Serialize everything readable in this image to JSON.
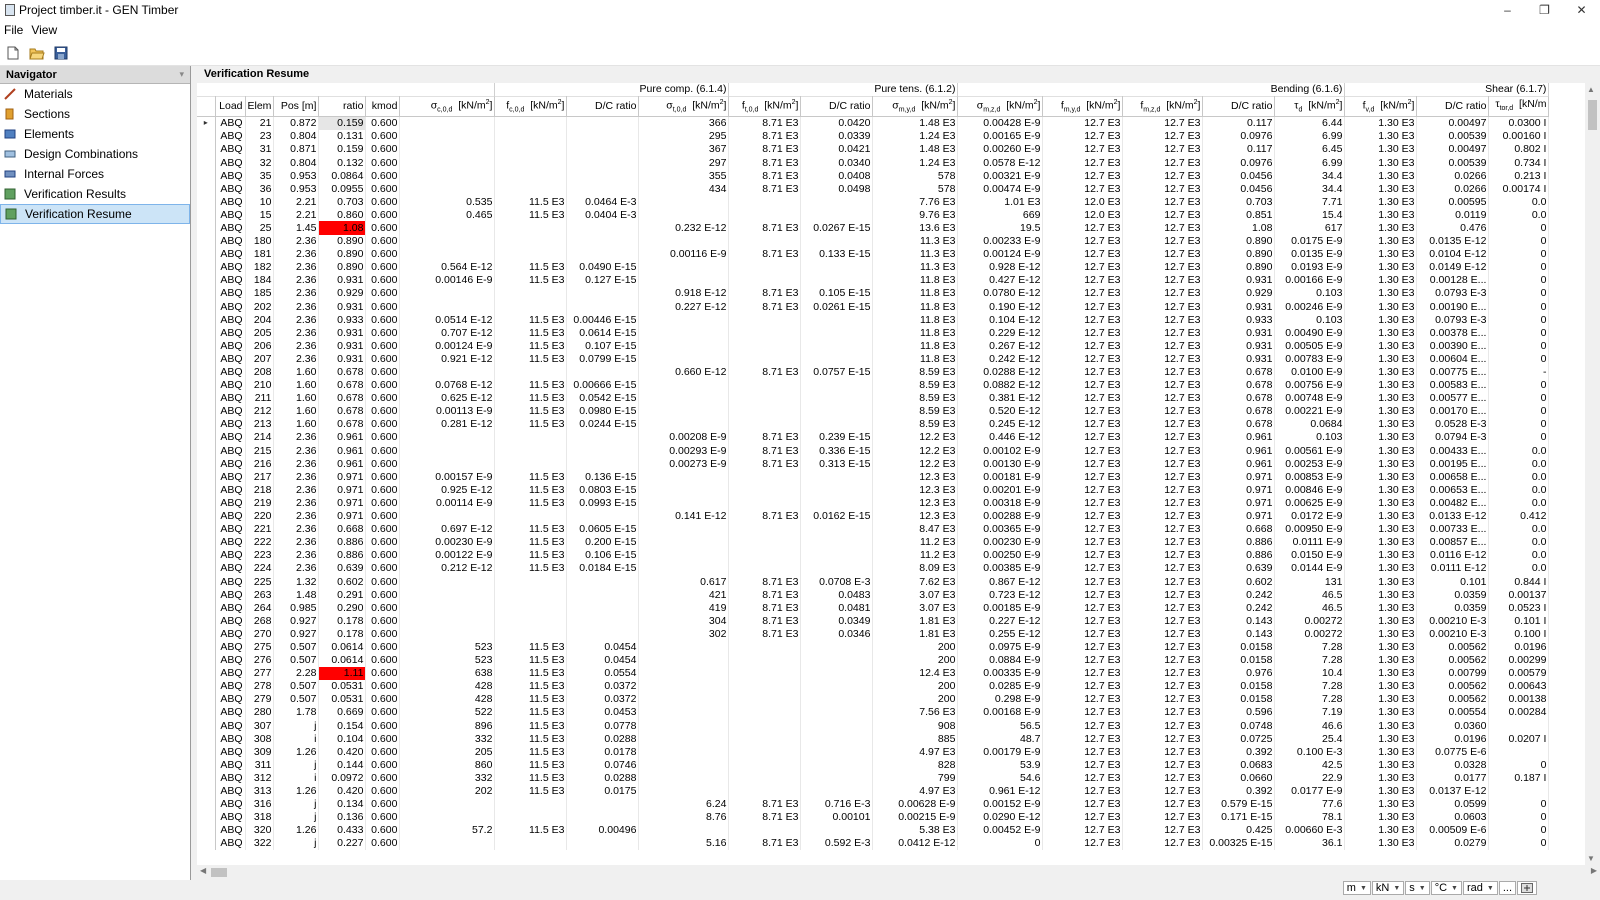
{
  "window": {
    "title": "Project timber.it - GEN Timber",
    "minimize": "–",
    "maximize": "❐",
    "close": "✕"
  },
  "menu": [
    "File",
    "View"
  ],
  "toolbar": [
    "new-file-icon",
    "open-folder-icon",
    "save-icon"
  ],
  "navigator": {
    "title": "Navigator",
    "items": [
      {
        "label": "Materials",
        "icon": "materials-icon"
      },
      {
        "label": "Sections",
        "icon": "sections-icon"
      },
      {
        "label": "Elements",
        "icon": "elements-icon"
      },
      {
        "label": "Design Combinations",
        "icon": "design-combinations-icon"
      },
      {
        "label": "Internal Forces",
        "icon": "internal-forces-icon"
      },
      {
        "label": "Verification Results",
        "icon": "verification-results-icon"
      },
      {
        "label": "Verification Resume",
        "icon": "verification-resume-icon",
        "selected": true
      }
    ]
  },
  "panel_title": "Verification Resume",
  "colors": {
    "highlight_red": "#ff0000",
    "selection_bg": "#cce4f7"
  },
  "column_groups": [
    {
      "label": "",
      "span": 7
    },
    {
      "label": "Pure comp. (6.1.4)",
      "span": 3
    },
    {
      "label": "Pure tens. (6.1.2)",
      "span": 3
    },
    {
      "label": "Bending (6.1.6)",
      "span": 5
    },
    {
      "label": "Shear (6.1.7)",
      "span": 3
    }
  ],
  "columns": [
    "",
    "Load",
    "Elem",
    "Pos [m]",
    "ratio",
    "kmod",
    "σc,0,d  [kN/m2]",
    "fc,0,d  [kN/m2]",
    "D/C ratio",
    "σt,0,d  [kN/m2]",
    "ft,0,d  [kN/m2]",
    "D/C ratio",
    "σm,y,d  [kN/m2]",
    "σm,z,d  [kN/m2]",
    "fm,y,d  [kN/m2]",
    "fm,z,d  [kN/m2]",
    "D/C ratio",
    "τd  [kN/m2]",
    "fv,d  [kN/m2]",
    "D/C ratio",
    "τtor,d  [kN/m"
  ],
  "rows": [
    [
      "ABQ",
      "21",
      "0.872",
      "0.159",
      "0.600",
      "",
      "",
      "",
      "366",
      "8.71 E3",
      "0.0420",
      "1.48 E3",
      "0.00428 E-9",
      "12.7 E3",
      "12.7 E3",
      "0.117",
      "6.44",
      "1.30 E3",
      "0.00497",
      "0.0300 I"
    ],
    [
      "ABQ",
      "23",
      "0.804",
      "0.131",
      "0.600",
      "",
      "",
      "",
      "295",
      "8.71 E3",
      "0.0339",
      "1.24 E3",
      "0.00165 E-9",
      "12.7 E3",
      "12.7 E3",
      "0.0976",
      "6.99",
      "1.30 E3",
      "0.00539",
      "0.00160 I"
    ],
    [
      "ABQ",
      "31",
      "0.871",
      "0.159",
      "0.600",
      "",
      "",
      "",
      "367",
      "8.71 E3",
      "0.0421",
      "1.48 E3",
      "0.00260 E-9",
      "12.7 E3",
      "12.7 E3",
      "0.117",
      "6.45",
      "1.30 E3",
      "0.00497",
      "0.802 I"
    ],
    [
      "ABQ",
      "32",
      "0.804",
      "0.132",
      "0.600",
      "",
      "",
      "",
      "297",
      "8.71 E3",
      "0.0340",
      "1.24 E3",
      "0.0578 E-12",
      "12.7 E3",
      "12.7 E3",
      "0.0976",
      "6.99",
      "1.30 E3",
      "0.00539",
      "0.734 I"
    ],
    [
      "ABQ",
      "35",
      "0.953",
      "0.0864",
      "0.600",
      "",
      "",
      "",
      "355",
      "8.71 E3",
      "0.0408",
      "578",
      "0.00321 E-9",
      "12.7 E3",
      "12.7 E3",
      "0.0456",
      "34.4",
      "1.30 E3",
      "0.0266",
      "0.213 I"
    ],
    [
      "ABQ",
      "36",
      "0.953",
      "0.0955",
      "0.600",
      "",
      "",
      "",
      "434",
      "8.71 E3",
      "0.0498",
      "578",
      "0.00474 E-9",
      "12.7 E3",
      "12.7 E3",
      "0.0456",
      "34.4",
      "1.30 E3",
      "0.0266",
      "0.00174 I"
    ],
    [
      "ABQ",
      "10",
      "2.21",
      "0.703",
      "0.600",
      "0.535",
      "11.5 E3",
      "0.0464 E-3",
      "",
      "",
      "",
      "7.76 E3",
      "1.01 E3",
      "12.0 E3",
      "12.7 E3",
      "0.703",
      "7.71",
      "1.30 E3",
      "0.00595",
      "0.0"
    ],
    [
      "ABQ",
      "15",
      "2.21",
      "0.860",
      "0.600",
      "0.465",
      "11.5 E3",
      "0.0404 E-3",
      "",
      "",
      "",
      "9.76 E3",
      "669",
      "12.0 E3",
      "12.7 E3",
      "0.851",
      "15.4",
      "1.30 E3",
      "0.0119",
      "0.0"
    ],
    [
      "ABQ",
      "25",
      "1.45",
      "1.08",
      "0.600",
      "",
      "",
      "",
      "0.232 E-12",
      "8.71 E3",
      "0.0267 E-15",
      "13.6 E3",
      "19.5",
      "12.7 E3",
      "12.7 E3",
      "1.08",
      "617",
      "1.30 E3",
      "0.476",
      "0"
    ],
    [
      "ABQ",
      "180",
      "2.36",
      "0.890",
      "0.600",
      "",
      "",
      "",
      "",
      "",
      "",
      "11.3 E3",
      "0.00233 E-9",
      "12.7 E3",
      "12.7 E3",
      "0.890",
      "0.0175 E-9",
      "1.30 E3",
      "0.0135 E-12",
      "0"
    ],
    [
      "ABQ",
      "181",
      "2.36",
      "0.890",
      "0.600",
      "",
      "",
      "",
      "0.00116 E-9",
      "8.71 E3",
      "0.133 E-15",
      "11.3 E3",
      "0.00124 E-9",
      "12.7 E3",
      "12.7 E3",
      "0.890",
      "0.0135 E-9",
      "1.30 E3",
      "0.0104 E-12",
      "0"
    ],
    [
      "ABQ",
      "182",
      "2.36",
      "0.890",
      "0.600",
      "0.564 E-12",
      "11.5 E3",
      "0.0490 E-15",
      "",
      "",
      "",
      "11.3 E3",
      "0.928 E-12",
      "12.7 E3",
      "12.7 E3",
      "0.890",
      "0.0193 E-9",
      "1.30 E3",
      "0.0149 E-12",
      "0"
    ],
    [
      "ABQ",
      "184",
      "2.36",
      "0.931",
      "0.600",
      "0.00146 E-9",
      "11.5 E3",
      "0.127 E-15",
      "",
      "",
      "",
      "11.8 E3",
      "0.427 E-12",
      "12.7 E3",
      "12.7 E3",
      "0.931",
      "0.00166 E-9",
      "1.30 E3",
      "0.00128 E...",
      "0"
    ],
    [
      "ABQ",
      "185",
      "2.36",
      "0.929",
      "0.600",
      "",
      "",
      "",
      "0.918 E-12",
      "8.71 E3",
      "0.105 E-15",
      "11.8 E3",
      "0.0780 E-12",
      "12.7 E3",
      "12.7 E3",
      "0.929",
      "0.103",
      "1.30 E3",
      "0.0793 E-3",
      "0"
    ],
    [
      "ABQ",
      "202",
      "2.36",
      "0.931",
      "0.600",
      "",
      "",
      "",
      "0.227 E-12",
      "8.71 E3",
      "0.0261 E-15",
      "11.8 E3",
      "0.190 E-12",
      "12.7 E3",
      "12.7 E3",
      "0.931",
      "0.00246 E-9",
      "1.30 E3",
      "0.00190 E...",
      "0"
    ],
    [
      "ABQ",
      "204",
      "2.36",
      "0.933",
      "0.600",
      "0.0514 E-12",
      "11.5 E3",
      "0.00446 E-15",
      "",
      "",
      "",
      "11.8 E3",
      "0.104 E-12",
      "12.7 E3",
      "12.7 E3",
      "0.933",
      "0.103",
      "1.30 E3",
      "0.0793 E-3",
      "0"
    ],
    [
      "ABQ",
      "205",
      "2.36",
      "0.931",
      "0.600",
      "0.707 E-12",
      "11.5 E3",
      "0.0614 E-15",
      "",
      "",
      "",
      "11.8 E3",
      "0.229 E-12",
      "12.7 E3",
      "12.7 E3",
      "0.931",
      "0.00490 E-9",
      "1.30 E3",
      "0.00378 E...",
      "0"
    ],
    [
      "ABQ",
      "206",
      "2.36",
      "0.931",
      "0.600",
      "0.00124 E-9",
      "11.5 E3",
      "0.107 E-15",
      "",
      "",
      "",
      "11.8 E3",
      "0.267 E-12",
      "12.7 E3",
      "12.7 E3",
      "0.931",
      "0.00505 E-9",
      "1.30 E3",
      "0.00390 E...",
      "0"
    ],
    [
      "ABQ",
      "207",
      "2.36",
      "0.931",
      "0.600",
      "0.921 E-12",
      "11.5 E3",
      "0.0799 E-15",
      "",
      "",
      "",
      "11.8 E3",
      "0.242 E-12",
      "12.7 E3",
      "12.7 E3",
      "0.931",
      "0.00783 E-9",
      "1.30 E3",
      "0.00604 E...",
      "0"
    ],
    [
      "ABQ",
      "208",
      "1.60",
      "0.678",
      "0.600",
      "",
      "",
      "",
      "0.660 E-12",
      "8.71 E3",
      "0.0757 E-15",
      "8.59 E3",
      "0.0288 E-12",
      "12.7 E3",
      "12.7 E3",
      "0.678",
      "0.0100 E-9",
      "1.30 E3",
      "0.00775 E...",
      "-"
    ],
    [
      "ABQ",
      "210",
      "1.60",
      "0.678",
      "0.600",
      "0.0768 E-12",
      "11.5 E3",
      "0.00666 E-15",
      "",
      "",
      "",
      "8.59 E3",
      "0.0882 E-12",
      "12.7 E3",
      "12.7 E3",
      "0.678",
      "0.00756 E-9",
      "1.30 E3",
      "0.00583 E...",
      "0"
    ],
    [
      "ABQ",
      "211",
      "1.60",
      "0.678",
      "0.600",
      "0.625 E-12",
      "11.5 E3",
      "0.0542 E-15",
      "",
      "",
      "",
      "8.59 E3",
      "0.381 E-12",
      "12.7 E3",
      "12.7 E3",
      "0.678",
      "0.00748 E-9",
      "1.30 E3",
      "0.00577 E...",
      "0"
    ],
    [
      "ABQ",
      "212",
      "1.60",
      "0.678",
      "0.600",
      "0.00113 E-9",
      "11.5 E3",
      "0.0980 E-15",
      "",
      "",
      "",
      "8.59 E3",
      "0.520 E-12",
      "12.7 E3",
      "12.7 E3",
      "0.678",
      "0.00221 E-9",
      "1.30 E3",
      "0.00170 E...",
      "0"
    ],
    [
      "ABQ",
      "213",
      "1.60",
      "0.678",
      "0.600",
      "0.281 E-12",
      "11.5 E3",
      "0.0244 E-15",
      "",
      "",
      "",
      "8.59 E3",
      "0.245 E-12",
      "12.7 E3",
      "12.7 E3",
      "0.678",
      "0.0684",
      "1.30 E3",
      "0.0528 E-3",
      "0"
    ],
    [
      "ABQ",
      "214",
      "2.36",
      "0.961",
      "0.600",
      "",
      "",
      "",
      "0.00208 E-9",
      "8.71 E3",
      "0.239 E-15",
      "12.2 E3",
      "0.446 E-12",
      "12.7 E3",
      "12.7 E3",
      "0.961",
      "0.103",
      "1.30 E3",
      "0.0794 E-3",
      "0"
    ],
    [
      "ABQ",
      "215",
      "2.36",
      "0.961",
      "0.600",
      "",
      "",
      "",
      "0.00293 E-9",
      "8.71 E3",
      "0.336 E-15",
      "12.2 E3",
      "0.00102 E-9",
      "12.7 E3",
      "12.7 E3",
      "0.961",
      "0.00561 E-9",
      "1.30 E3",
      "0.00433 E...",
      "0.0"
    ],
    [
      "ABQ",
      "216",
      "2.36",
      "0.961",
      "0.600",
      "",
      "",
      "",
      "0.00273 E-9",
      "8.71 E3",
      "0.313 E-15",
      "12.2 E3",
      "0.00130 E-9",
      "12.7 E3",
      "12.7 E3",
      "0.961",
      "0.00253 E-9",
      "1.30 E3",
      "0.00195 E...",
      "0.0"
    ],
    [
      "ABQ",
      "217",
      "2.36",
      "0.971",
      "0.600",
      "0.00157 E-9",
      "11.5 E3",
      "0.136 E-15",
      "",
      "",
      "",
      "12.3 E3",
      "0.00181 E-9",
      "12.7 E3",
      "12.7 E3",
      "0.971",
      "0.00853 E-9",
      "1.30 E3",
      "0.00658 E...",
      "0.0"
    ],
    [
      "ABQ",
      "218",
      "2.36",
      "0.971",
      "0.600",
      "0.925 E-12",
      "11.5 E3",
      "0.0803 E-15",
      "",
      "",
      "",
      "12.3 E3",
      "0.00201 E-9",
      "12.7 E3",
      "12.7 E3",
      "0.971",
      "0.00846 E-9",
      "1.30 E3",
      "0.00653 E...",
      "0.0"
    ],
    [
      "ABQ",
      "219",
      "2.36",
      "0.971",
      "0.600",
      "0.00114 E-9",
      "11.5 E3",
      "0.0993 E-15",
      "",
      "",
      "",
      "12.3 E3",
      "0.00318 E-9",
      "12.7 E3",
      "12.7 E3",
      "0.971",
      "0.00625 E-9",
      "1.30 E3",
      "0.00482 E...",
      "0.0"
    ],
    [
      "ABQ",
      "220",
      "2.36",
      "0.971",
      "0.600",
      "",
      "",
      "",
      "0.141 E-12",
      "8.71 E3",
      "0.0162 E-15",
      "12.3 E3",
      "0.00288 E-9",
      "12.7 E3",
      "12.7 E3",
      "0.971",
      "0.0172 E-9",
      "1.30 E3",
      "0.0133 E-12",
      "0.412"
    ],
    [
      "ABQ",
      "221",
      "2.36",
      "0.668",
      "0.600",
      "0.697 E-12",
      "11.5 E3",
      "0.0605 E-15",
      "",
      "",
      "",
      "8.47 E3",
      "0.00365 E-9",
      "12.7 E3",
      "12.7 E3",
      "0.668",
      "0.00950 E-9",
      "1.30 E3",
      "0.00733 E...",
      "0.0"
    ],
    [
      "ABQ",
      "222",
      "2.36",
      "0.886",
      "0.600",
      "0.00230 E-9",
      "11.5 E3",
      "0.200 E-15",
      "",
      "",
      "",
      "11.2 E3",
      "0.00230 E-9",
      "12.7 E3",
      "12.7 E3",
      "0.886",
      "0.0111 E-9",
      "1.30 E3",
      "0.00857 E...",
      "0.0"
    ],
    [
      "ABQ",
      "223",
      "2.36",
      "0.886",
      "0.600",
      "0.00122 E-9",
      "11.5 E3",
      "0.106 E-15",
      "",
      "",
      "",
      "11.2 E3",
      "0.00250 E-9",
      "12.7 E3",
      "12.7 E3",
      "0.886",
      "0.0150 E-9",
      "1.30 E3",
      "0.0116 E-12",
      "0.0"
    ],
    [
      "ABQ",
      "224",
      "2.36",
      "0.639",
      "0.600",
      "0.212 E-12",
      "11.5 E3",
      "0.0184 E-15",
      "",
      "",
      "",
      "8.09 E3",
      "0.00385 E-9",
      "12.7 E3",
      "12.7 E3",
      "0.639",
      "0.0144 E-9",
      "1.30 E3",
      "0.0111 E-12",
      "0.0"
    ],
    [
      "ABQ",
      "225",
      "1.32",
      "0.602",
      "0.600",
      "",
      "",
      "",
      "0.617",
      "8.71 E3",
      "0.0708 E-3",
      "7.62 E3",
      "0.867 E-12",
      "12.7 E3",
      "12.7 E3",
      "0.602",
      "131",
      "1.30 E3",
      "0.101",
      "0.844 I"
    ],
    [
      "ABQ",
      "263",
      "1.48",
      "0.291",
      "0.600",
      "",
      "",
      "",
      "421",
      "8.71 E3",
      "0.0483",
      "3.07 E3",
      "0.723 E-12",
      "12.7 E3",
      "12.7 E3",
      "0.242",
      "46.5",
      "1.30 E3",
      "0.0359",
      "0.00137"
    ],
    [
      "ABQ",
      "264",
      "0.985",
      "0.290",
      "0.600",
      "",
      "",
      "",
      "419",
      "8.71 E3",
      "0.0481",
      "3.07 E3",
      "0.00185 E-9",
      "12.7 E3",
      "12.7 E3",
      "0.242",
      "46.5",
      "1.30 E3",
      "0.0359",
      "0.0523 I"
    ],
    [
      "ABQ",
      "268",
      "0.927",
      "0.178",
      "0.600",
      "",
      "",
      "",
      "304",
      "8.71 E3",
      "0.0349",
      "1.81 E3",
      "0.227 E-12",
      "12.7 E3",
      "12.7 E3",
      "0.143",
      "0.00272",
      "1.30 E3",
      "0.00210 E-3",
      "0.101 I"
    ],
    [
      "ABQ",
      "270",
      "0.927",
      "0.178",
      "0.600",
      "",
      "",
      "",
      "302",
      "8.71 E3",
      "0.0346",
      "1.81 E3",
      "0.255 E-12",
      "12.7 E3",
      "12.7 E3",
      "0.143",
      "0.00272",
      "1.30 E3",
      "0.00210 E-3",
      "0.100 I"
    ],
    [
      "ABQ",
      "275",
      "0.507",
      "0.0614",
      "0.600",
      "523",
      "11.5 E3",
      "0.0454",
      "",
      "",
      "",
      "200",
      "0.0975 E-9",
      "12.7 E3",
      "12.7 E3",
      "0.0158",
      "7.28",
      "1.30 E3",
      "0.00562",
      "0.0196"
    ],
    [
      "ABQ",
      "276",
      "0.507",
      "0.0614",
      "0.600",
      "523",
      "11.5 E3",
      "0.0454",
      "",
      "",
      "",
      "200",
      "0.0884 E-9",
      "12.7 E3",
      "12.7 E3",
      "0.0158",
      "7.28",
      "1.30 E3",
      "0.00562",
      "0.00299"
    ],
    [
      "ABQ",
      "277",
      "2.28",
      "1.11",
      "0.600",
      "638",
      "11.5 E3",
      "0.0554",
      "",
      "",
      "",
      "12.4 E3",
      "0.00335 E-9",
      "12.7 E3",
      "12.7 E3",
      "0.976",
      "10.4",
      "1.30 E3",
      "0.00799",
      "0.00579"
    ],
    [
      "ABQ",
      "278",
      "0.507",
      "0.0531",
      "0.600",
      "428",
      "11.5 E3",
      "0.0372",
      "",
      "",
      "",
      "200",
      "0.0285 E-9",
      "12.7 E3",
      "12.7 E3",
      "0.0158",
      "7.28",
      "1.30 E3",
      "0.00562",
      "0.00643"
    ],
    [
      "ABQ",
      "279",
      "0.507",
      "0.0531",
      "0.600",
      "428",
      "11.5 E3",
      "0.0372",
      "",
      "",
      "",
      "200",
      "0.298 E-9",
      "12.7 E3",
      "12.7 E3",
      "0.0158",
      "7.28",
      "1.30 E3",
      "0.00562",
      "0.00138"
    ],
    [
      "ABQ",
      "280",
      "1.78",
      "0.669",
      "0.600",
      "522",
      "11.5 E3",
      "0.0453",
      "",
      "",
      "",
      "7.56 E3",
      "0.00168 E-9",
      "12.7 E3",
      "12.7 E3",
      "0.596",
      "7.19",
      "1.30 E3",
      "0.00554",
      "0.00284"
    ],
    [
      "ABQ",
      "307",
      "j",
      "0.154",
      "0.600",
      "896",
      "11.5 E3",
      "0.0778",
      "",
      "",
      "",
      "908",
      "56.5",
      "12.7 E3",
      "12.7 E3",
      "0.0748",
      "46.6",
      "1.30 E3",
      "0.0360",
      ""
    ],
    [
      "ABQ",
      "308",
      "i",
      "0.104",
      "0.600",
      "332",
      "11.5 E3",
      "0.0288",
      "",
      "",
      "",
      "885",
      "48.7",
      "12.7 E3",
      "12.7 E3",
      "0.0725",
      "25.4",
      "1.30 E3",
      "0.0196",
      "0.0207 I"
    ],
    [
      "ABQ",
      "309",
      "1.26",
      "0.420",
      "0.600",
      "205",
      "11.5 E3",
      "0.0178",
      "",
      "",
      "",
      "4.97 E3",
      "0.00179 E-9",
      "12.7 E3",
      "12.7 E3",
      "0.392",
      "0.100 E-3",
      "1.30 E3",
      "0.0775 E-6",
      ""
    ],
    [
      "ABQ",
      "311",
      "j",
      "0.144",
      "0.600",
      "860",
      "11.5 E3",
      "0.0746",
      "",
      "",
      "",
      "828",
      "53.9",
      "12.7 E3",
      "12.7 E3",
      "0.0683",
      "42.5",
      "1.30 E3",
      "0.0328",
      "0"
    ],
    [
      "ABQ",
      "312",
      "i",
      "0.0972",
      "0.600",
      "332",
      "11.5 E3",
      "0.0288",
      "",
      "",
      "",
      "799",
      "54.6",
      "12.7 E3",
      "12.7 E3",
      "0.0660",
      "22.9",
      "1.30 E3",
      "0.0177",
      "0.187 I"
    ],
    [
      "ABQ",
      "313",
      "1.26",
      "0.420",
      "0.600",
      "202",
      "11.5 E3",
      "0.0175",
      "",
      "",
      "",
      "4.97 E3",
      "0.961 E-12",
      "12.7 E3",
      "12.7 E3",
      "0.392",
      "0.0177 E-9",
      "1.30 E3",
      "0.0137 E-12",
      ""
    ],
    [
      "ABQ",
      "316",
      "j",
      "0.134",
      "0.600",
      "",
      "",
      "",
      "6.24",
      "8.71 E3",
      "0.716 E-3",
      "0.00628 E-9",
      "0.00152 E-9",
      "12.7 E3",
      "12.7 E3",
      "0.579 E-15",
      "77.6",
      "1.30 E3",
      "0.0599",
      "0"
    ],
    [
      "ABQ",
      "318",
      "j",
      "0.136",
      "0.600",
      "",
      "",
      "",
      "8.76",
      "8.71 E3",
      "0.00101",
      "0.00215 E-9",
      "0.0290 E-12",
      "12.7 E3",
      "12.7 E3",
      "0.171 E-15",
      "78.1",
      "1.30 E3",
      "0.0603",
      "0"
    ],
    [
      "ABQ",
      "320",
      "1.26",
      "0.433",
      "0.600",
      "57.2",
      "11.5 E3",
      "0.00496",
      "",
      "",
      "",
      "5.38 E3",
      "0.00452 E-9",
      "12.7 E3",
      "12.7 E3",
      "0.425",
      "0.00660 E-3",
      "1.30 E3",
      "0.00509 E-6",
      "0"
    ],
    [
      "ABQ",
      "322",
      "j",
      "0.227",
      "0.600",
      "",
      "",
      "",
      "5.16",
      "8.71 E3",
      "0.592 E-3",
      "0.0412 E-12",
      "0",
      "12.7 E3",
      "12.7 E3",
      "0.00325 E-15",
      "36.1",
      "1.30 E3",
      "0.0279",
      "0"
    ]
  ],
  "current_row_marker": "▸",
  "red_ratio_rows": [
    8,
    42
  ],
  "selected_cell_row": 0,
  "units": [
    {
      "value": "m"
    },
    {
      "value": "kN"
    },
    {
      "value": "s"
    },
    {
      "value": "°C"
    },
    {
      "value": "rad"
    },
    {
      "value": "..."
    }
  ]
}
